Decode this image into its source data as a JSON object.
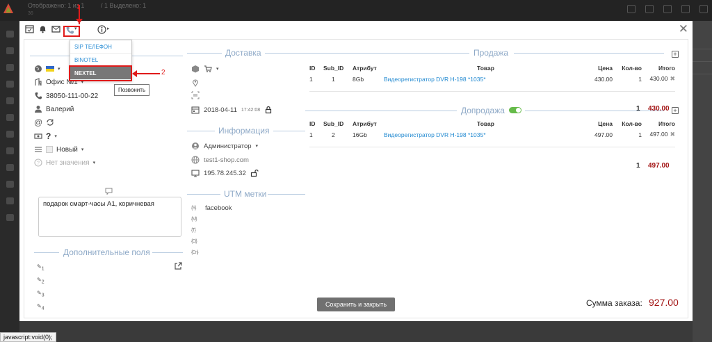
{
  "background": {
    "top_title": "Отображено: 1 из 1",
    "top_subtitle": "36",
    "top_selected": "/ 1 Выделено: 1"
  },
  "toolbar": {
    "calendar_icon": "calendar-icon",
    "bell_icon": "bell-icon",
    "mail_icon": "mail-icon",
    "phone_icon": "phone-icon",
    "info_icon": "info-icon",
    "caret": "▾",
    "info_caret": "▸",
    "close": "✕"
  },
  "phone_menu": {
    "items": [
      "SIP ТЕЛЕФОН",
      "BINOTEL",
      "NEXTEL"
    ],
    "active_index": 2,
    "tooltip": "Позвонить"
  },
  "annotations": {
    "one": "1",
    "two": "2"
  },
  "left": {
    "office": "Офис №1",
    "phone": "38050-111-00-22",
    "name": "Валерий",
    "question": "?",
    "status": "Новый",
    "no_value": "Нет значения",
    "comment": "подарок смарт-часы A1, коричневая",
    "extra_fields_title": "Дополнительные поля",
    "pencils": [
      "1",
      "2",
      "3",
      "4"
    ]
  },
  "middle": {
    "delivery_title": "Доставка",
    "date": "2018-04-11",
    "time": "17:42:08",
    "info_title": "Информация",
    "admin": "Администратор",
    "site": "test1-shop.com",
    "ip": "195.78.245.32",
    "utm_title": "UTM метки",
    "utm": [
      {
        "code": "{S}",
        "value": "facebook"
      },
      {
        "code": "{M}",
        "value": ""
      },
      {
        "code": "{T}",
        "value": ""
      },
      {
        "code": "{Ct}",
        "value": ""
      },
      {
        "code": "{Cn}",
        "value": ""
      }
    ]
  },
  "sale": {
    "title": "Продажа",
    "headers": [
      "ID",
      "Sub_ID",
      "Атрибут",
      "Товар",
      "Цена",
      "Кол-во",
      "Итого"
    ],
    "rows": [
      {
        "id": "1",
        "sub_id": "1",
        "attr": "8Gb",
        "product": "Видеорегистратор DVR H-198 *1035*",
        "price": "430.00",
        "qty": "1",
        "total": "430.00"
      }
    ],
    "sum_qty": "1",
    "sum_total": "430.00"
  },
  "upsale": {
    "title": "Допродажа",
    "headers": [
      "ID",
      "Sub_ID",
      "Атрибут",
      "Товар",
      "Цена",
      "Кол-во",
      "Итого"
    ],
    "rows": [
      {
        "id": "1",
        "sub_id": "2",
        "attr": "16Gb",
        "product": "Видеорегистратор DVR H-198 *1035*",
        "price": "497.00",
        "qty": "1",
        "total": "497.00"
      }
    ],
    "sum_qty": "1",
    "sum_total": "497.00"
  },
  "footer": {
    "save_label": "Сохранить и закрыть",
    "sum_label": "Сумма заказа:",
    "sum_value": "927.00"
  },
  "status_bar": "javascript:void(0);",
  "colors": {
    "accent_red": "#e01a1a",
    "link": "#1f88d0",
    "total_red": "#a31515",
    "section_blue": "#8ea9c7"
  }
}
